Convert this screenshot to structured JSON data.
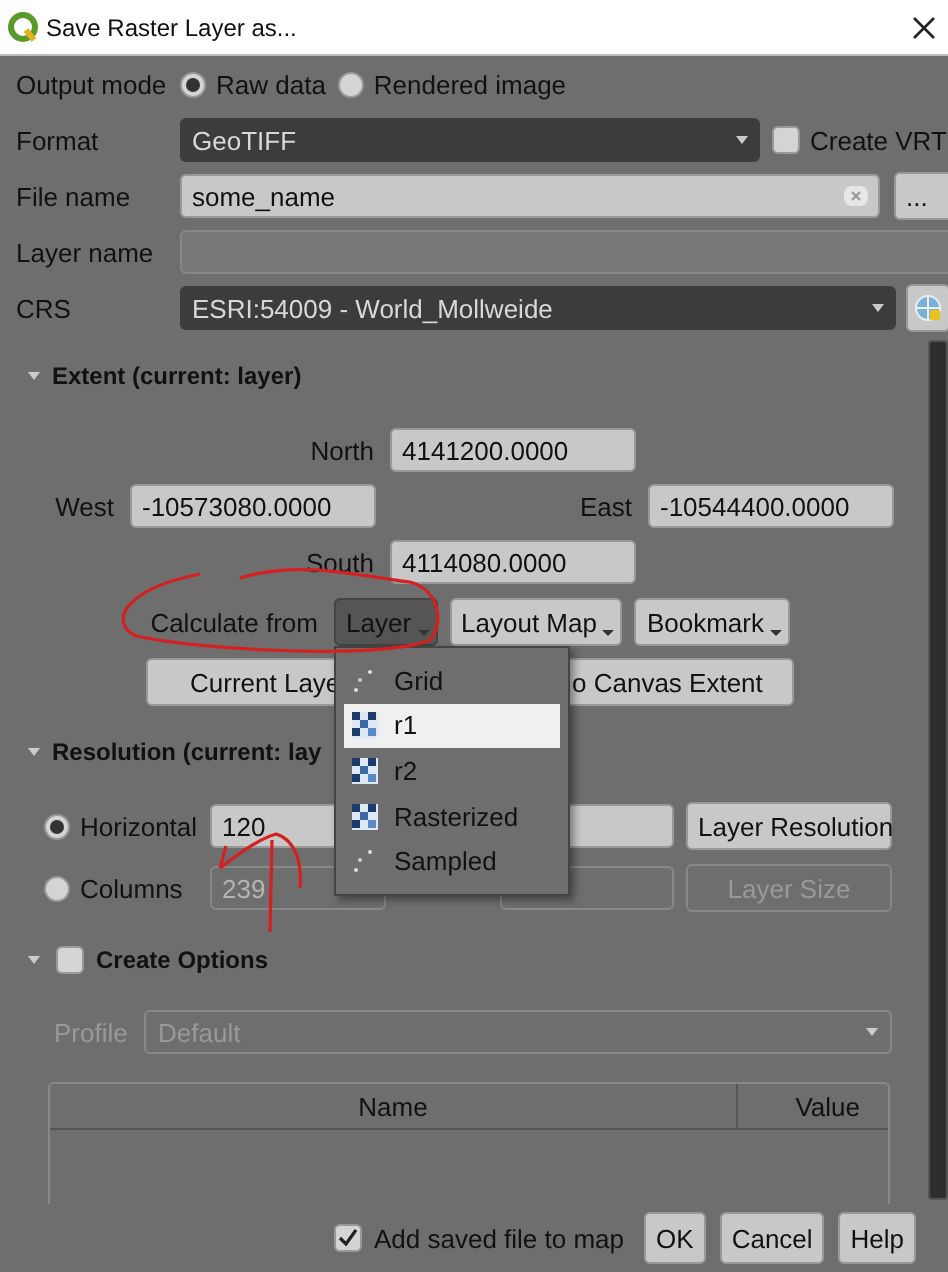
{
  "window": {
    "title": "Save Raster Layer as..."
  },
  "output_mode": {
    "label": "Output mode",
    "options": [
      {
        "label": "Raw data",
        "selected": true
      },
      {
        "label": "Rendered image",
        "selected": false
      }
    ]
  },
  "format": {
    "label": "Format",
    "value": "GeoTIFF",
    "create_vrt": {
      "label": "Create VRT",
      "checked": false
    }
  },
  "file_name": {
    "label": "File name",
    "value": "some_name",
    "browse": "..."
  },
  "layer_name": {
    "label": "Layer name"
  },
  "crs": {
    "label": "CRS",
    "value": "ESRI:54009 - World_Mollweide"
  },
  "extent": {
    "title": "Extent (current: layer)",
    "expanded": true,
    "north": {
      "label": "North",
      "value": "4141200.0000"
    },
    "west": {
      "label": "West",
      "value": "-10573080.0000"
    },
    "east": {
      "label": "East",
      "value": "-10544400.0000"
    },
    "south": {
      "label": "South",
      "value": "4114080.0000"
    },
    "calculate_label": "Calculate from",
    "calculate_buttons": [
      {
        "label": "Layer",
        "pressed": true
      },
      {
        "label": "Layout Map",
        "pressed": false
      },
      {
        "label": "Bookmark",
        "pressed": false
      }
    ],
    "buttons": [
      "Current Laye",
      "o Canvas Extent"
    ]
  },
  "resolution": {
    "title": "Resolution (current: lay",
    "expanded": true,
    "modes": [
      {
        "label": "Horizontal",
        "selected": true,
        "value": "120",
        "button": "Layer Resolution"
      },
      {
        "label": "Columns",
        "selected": false,
        "value": "239",
        "button": "Layer Size"
      }
    ]
  },
  "create_options": {
    "title": "Create Options",
    "checked": false,
    "expanded": true,
    "profile": {
      "label": "Profile",
      "value": "Default"
    },
    "table": {
      "columns": [
        "Name",
        "Value"
      ]
    }
  },
  "add_to_map": {
    "label": "Add saved file to map",
    "checked": true
  },
  "buttons": [
    "OK",
    "Cancel",
    "Help"
  ],
  "menu": {
    "items": [
      {
        "label": "Grid",
        "kind": "points",
        "selected": false
      },
      {
        "label": "r1",
        "kind": "raster",
        "selected": true
      },
      {
        "label": "r2",
        "kind": "raster",
        "selected": false
      },
      {
        "label": "Rasterized",
        "kind": "raster",
        "selected": false
      },
      {
        "label": "Sampled",
        "kind": "points",
        "selected": false
      }
    ]
  }
}
